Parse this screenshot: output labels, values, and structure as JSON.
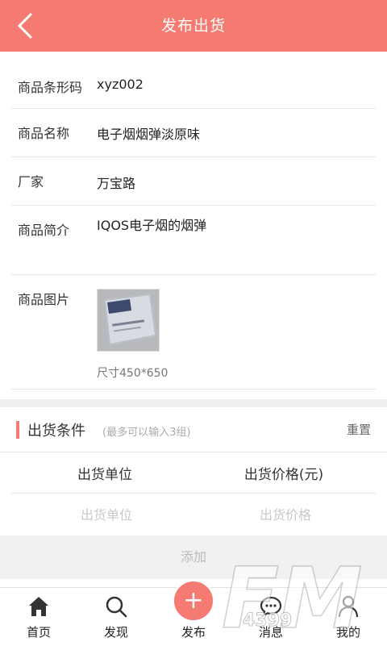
{
  "header": {
    "title": "发布出货",
    "back_icon": "chevron-left-icon"
  },
  "form": {
    "barcode": {
      "label": "商品条形码",
      "value": "xyz002"
    },
    "name": {
      "label": "商品名称",
      "value": "电子烟烟弹淡原味"
    },
    "maker": {
      "label": "厂家",
      "value": "万宝路"
    },
    "desc": {
      "label": "商品简介",
      "value": "IQOS电子烟的烟弹"
    },
    "image": {
      "label": "商品图片",
      "size_note": "尺寸450*650"
    }
  },
  "conditions": {
    "title": "出货条件",
    "hint": "(最多可以输入3组)",
    "reset": "重置",
    "col_unit": "出货单位",
    "col_price": "出货价格(元)",
    "unit_placeholder": "出货单位",
    "price_placeholder": "出货价格",
    "add": "添加"
  },
  "tabbar": {
    "home": "首页",
    "discover": "发现",
    "publish": "发布",
    "messages": "消息",
    "mine": "我的"
  },
  "colors": {
    "accent": "#f47a72"
  },
  "watermark": "FM 4399"
}
